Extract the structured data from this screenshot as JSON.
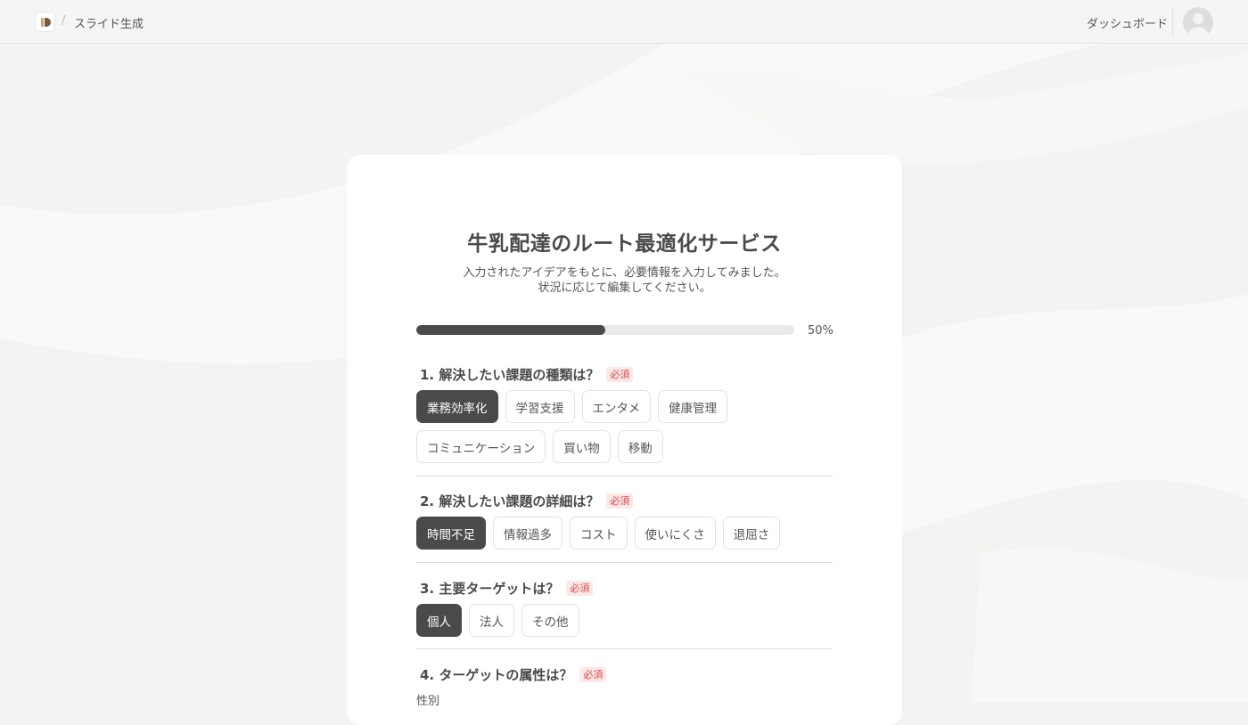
{
  "header": {
    "breadcrumb_separator": "/",
    "breadcrumb": "スライド生成",
    "dashboard_link": "ダッシュボード"
  },
  "main": {
    "title": "牛乳配達のルート最適化サービス",
    "subtitle_line1": "入力されたアイデアをもとに、必要情報を入力してみました。",
    "subtitle_line2": "状況に応じて編集してください。",
    "progress": {
      "percent": 50,
      "label": "50%"
    },
    "questions": [
      {
        "title": "1. 解決したい課題の種類は？",
        "required": "必須",
        "options": [
          "業務効率化",
          "学習支援",
          "エンタメ",
          "健康管理",
          "コミュニケーション",
          "買い物",
          "移動"
        ],
        "selected": "業務効率化"
      },
      {
        "title": "2. 解決したい課題の詳細は？",
        "required": "必須",
        "options": [
          "時間不足",
          "情報過多",
          "コスト",
          "使いにくさ",
          "退屈さ"
        ],
        "selected": "時間不足"
      },
      {
        "title": "3. 主要ターゲットは？",
        "required": "必須",
        "options": [
          "個人",
          "法人",
          "その他"
        ],
        "selected": "個人"
      },
      {
        "title": "4. ターゲットの属性は？",
        "required": "必須",
        "sublabel": "性別"
      }
    ]
  }
}
